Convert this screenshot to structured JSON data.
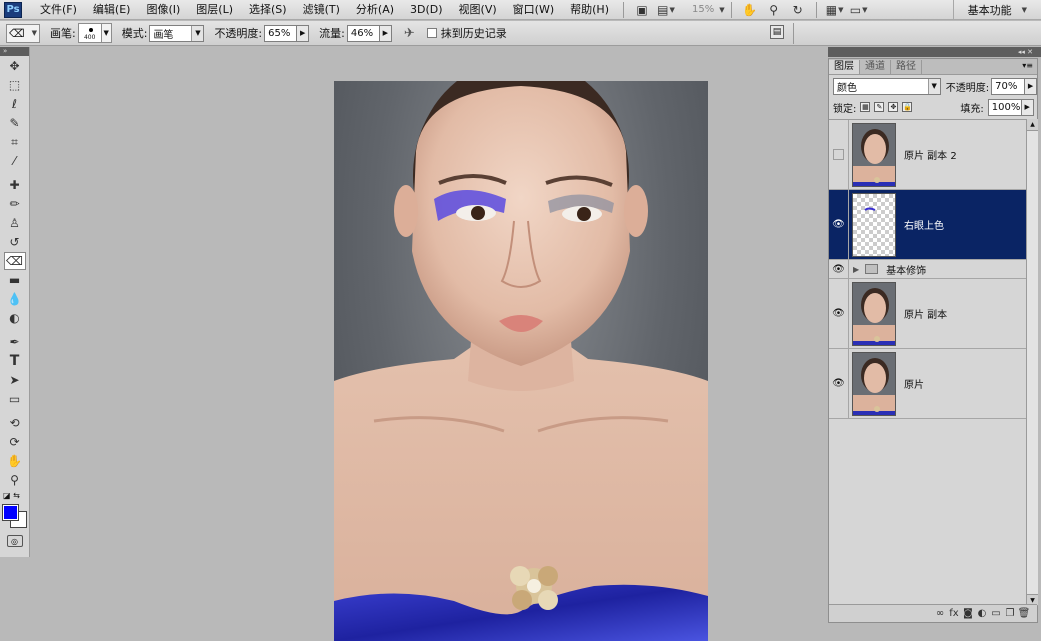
{
  "app": {
    "logo": "Ps",
    "workspace": "基本功能"
  },
  "menu": [
    "文件(F)",
    "编辑(E)",
    "图像(I)",
    "图层(L)",
    "选择(S)",
    "滤镜(T)",
    "分析(A)",
    "3D(D)",
    "视图(V)",
    "窗口(W)",
    "帮助(H)"
  ],
  "menubar_tools": {
    "zoom": "15%"
  },
  "options": {
    "brush_label": "画笔:",
    "brush_size": "400",
    "mode_label": "模式:",
    "mode_value": "画笔",
    "opacity_label": "不透明度:",
    "opacity_value": "65%",
    "flow_label": "流量:",
    "flow_value": "46%",
    "erase_history_label": "抹到历史记录"
  },
  "toolbox": {
    "tools": [
      "move-tool",
      "marquee-tool",
      "lasso-tool",
      "quick-select-tool",
      "crop-tool",
      "eyedropper-tool",
      "healing-tool",
      "brush-tool",
      "clone-stamp-tool",
      "history-brush-tool",
      "eraser-tool",
      "gradient-tool",
      "blur-tool",
      "dodge-tool",
      "pen-tool",
      "type-tool",
      "path-select-tool",
      "shape-tool",
      "3d-rotate-tool",
      "3d-orbit-tool",
      "hand-tool",
      "zoom-tool"
    ],
    "active_tool": "eraser-tool",
    "foreground_color": "#0000ff",
    "background_color": "#ffffff"
  },
  "layers_panel": {
    "tabs": [
      "图层",
      "通道",
      "路径"
    ],
    "blend_mode": "颜色",
    "opacity_label": "不透明度:",
    "opacity_value": "70%",
    "lock_label": "锁定:",
    "fill_label": "填充:",
    "fill_value": "100%",
    "layers": [
      {
        "name": "原片 副本 2",
        "visible": false,
        "selected": false,
        "kind": "photo"
      },
      {
        "name": "右眼上色",
        "visible": true,
        "selected": true,
        "kind": "transparent"
      },
      {
        "name": "基本修饰",
        "visible": true,
        "selected": false,
        "kind": "group"
      },
      {
        "name": "原片 副本",
        "visible": true,
        "selected": false,
        "kind": "photo"
      },
      {
        "name": "原片",
        "visible": true,
        "selected": false,
        "kind": "photo"
      }
    ]
  },
  "colors": {
    "selected_layer": "#0a2464",
    "eyeshadow": "#5a4be0",
    "dress": "#2a2fb5"
  }
}
